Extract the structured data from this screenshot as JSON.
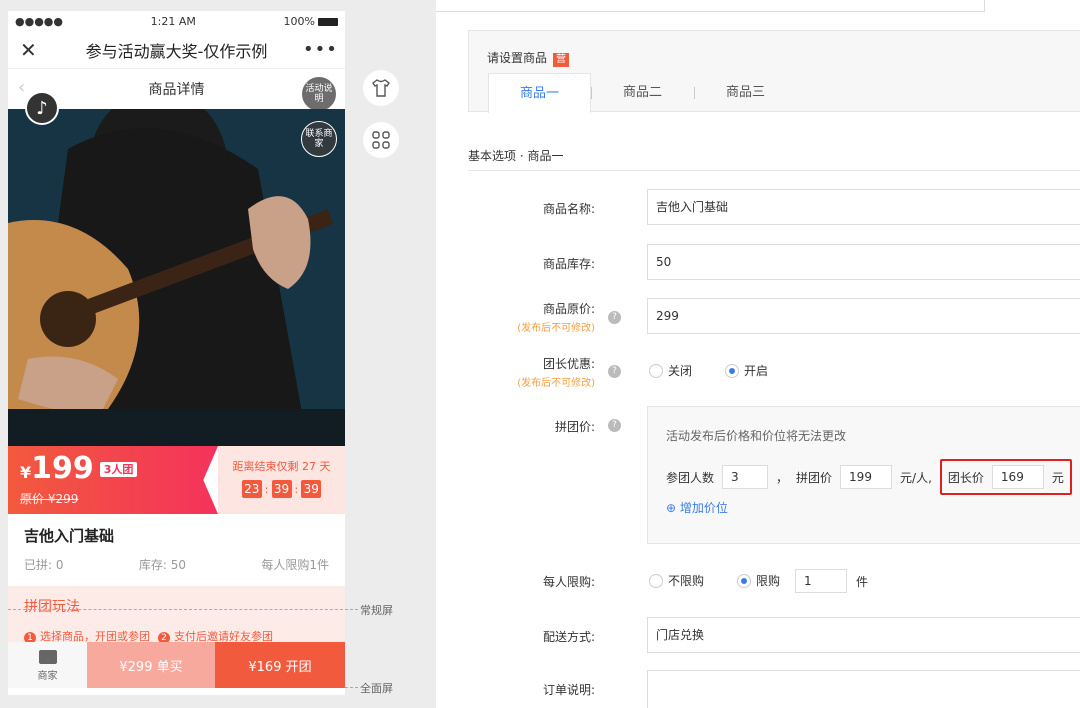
{
  "phone": {
    "status": {
      "signal": "●●●●●",
      "time": "1:21 AM",
      "battery": "100%"
    },
    "nav": {
      "close": "✕",
      "title": "参与活动赢大奖-仅作示例",
      "more": "•••"
    },
    "subtitle": "商品详情",
    "back": "‹",
    "activity_btn": "活动说明",
    "contact_btn": "联系商家",
    "price": {
      "currency": "¥",
      "amount": "199",
      "tag": "3人团",
      "original": "原价 ¥299"
    },
    "countdown": {
      "label": "距离结束仅剩 27 天",
      "h": "23",
      "m": "39",
      "s": "39",
      "sep": ":"
    },
    "product_name": "吉他入门基础",
    "stats": {
      "joined": "已拼: 0",
      "stock": "库存: 50",
      "limit": "每人限购1件"
    },
    "rules": {
      "title": "拼团玩法",
      "step1": "选择商品，开团或参团",
      "step2": "支付后邀请好友参团",
      "n1": "1",
      "n2": "2"
    },
    "bottom": {
      "shop": "商家",
      "buy": "¥299 单买",
      "group": "¥169 开团"
    }
  },
  "markers": {
    "normal": "常规屏",
    "full": "全面屏"
  },
  "form": {
    "header": {
      "label": "请设置商品",
      "badge": "营"
    },
    "tabs": [
      "商品一",
      "商品二",
      "商品三"
    ],
    "section": "基本选项 · 商品一",
    "fields": {
      "name_label": "商品名称:",
      "name_value": "吉他入门基础",
      "stock_label": "商品库存:",
      "stock_value": "50",
      "orig_label": "商品原价:",
      "orig_warn": "(发布后不可修改)",
      "orig_value": "299",
      "leader_label": "团长优惠:",
      "leader_warn": "(发布后不可修改)",
      "leader_off": "关闭",
      "leader_on": "开启",
      "group_label": "拼团价:",
      "group_note": "活动发布后价格和价位将无法更改",
      "people_label": "参团人数",
      "people_value": "3",
      "comma": "，",
      "gprice_label": "拼团价",
      "gprice_value": "199",
      "per": "元/人,",
      "lprice_label": "团长价",
      "lprice_value": "169",
      "yuan": "元",
      "add_price": "⊕ 增加价位",
      "limit_label": "每人限购:",
      "limit_off": "不限购",
      "limit_on": "限购",
      "limit_value": "1",
      "limit_unit": "件",
      "ship_label": "配送方式:",
      "ship_value": "门店兑换",
      "note_label": "订单说明:",
      "qm": "?"
    }
  }
}
